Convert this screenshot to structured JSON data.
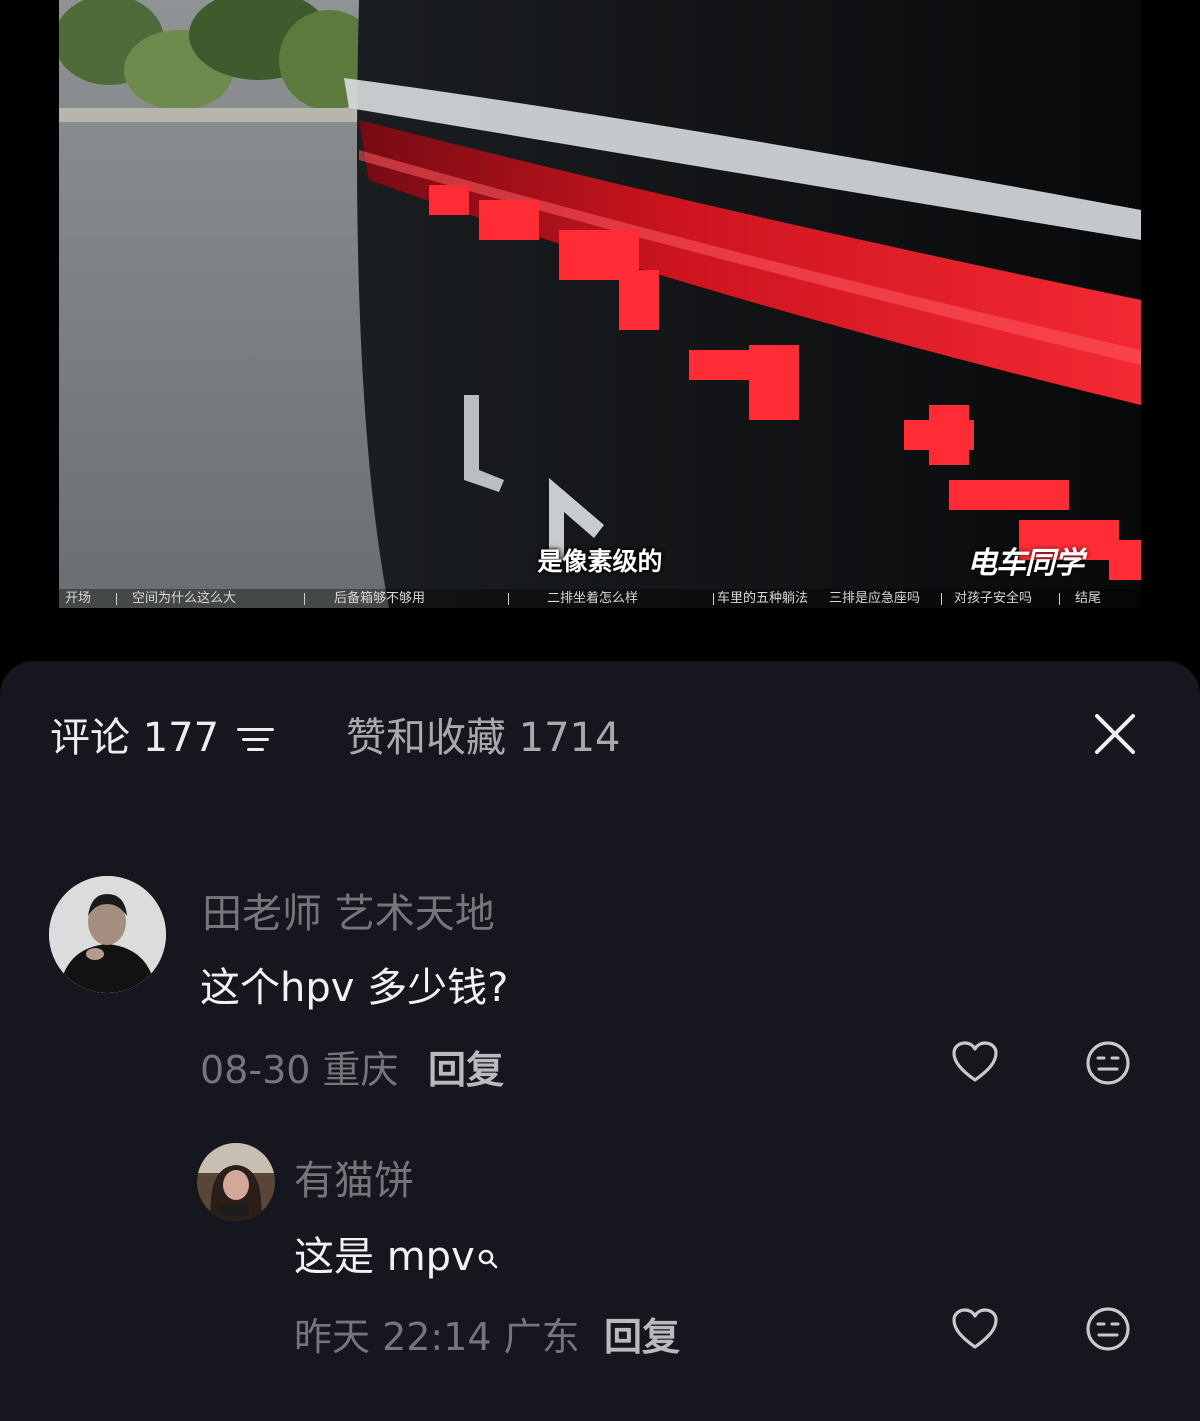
{
  "video": {
    "subtitle": "是像素级的",
    "watermark": "电车同学",
    "chapters": [
      "开场",
      "空间为什么这么大",
      "后备箱够不够用",
      "二排坐着怎么样",
      "车里的五种躺法",
      "三排是应急座吗",
      "对孩子安全吗",
      "结尾"
    ]
  },
  "tabs": {
    "comments": "评论 177",
    "likes": "赞和收藏 1714"
  },
  "comments": [
    {
      "username": "田老师 艺术天地",
      "text": "这个hpv 多少钱?",
      "meta": "08-30 重庆",
      "reply_label": "回复"
    },
    {
      "username": "有猫饼",
      "text": "这是 mpv",
      "meta": "昨天 22:14 广东",
      "reply_label": "回复"
    }
  ],
  "icons": [
    "sort-icon",
    "close-icon",
    "heart-icon",
    "meh-face-icon",
    "search-icon"
  ]
}
